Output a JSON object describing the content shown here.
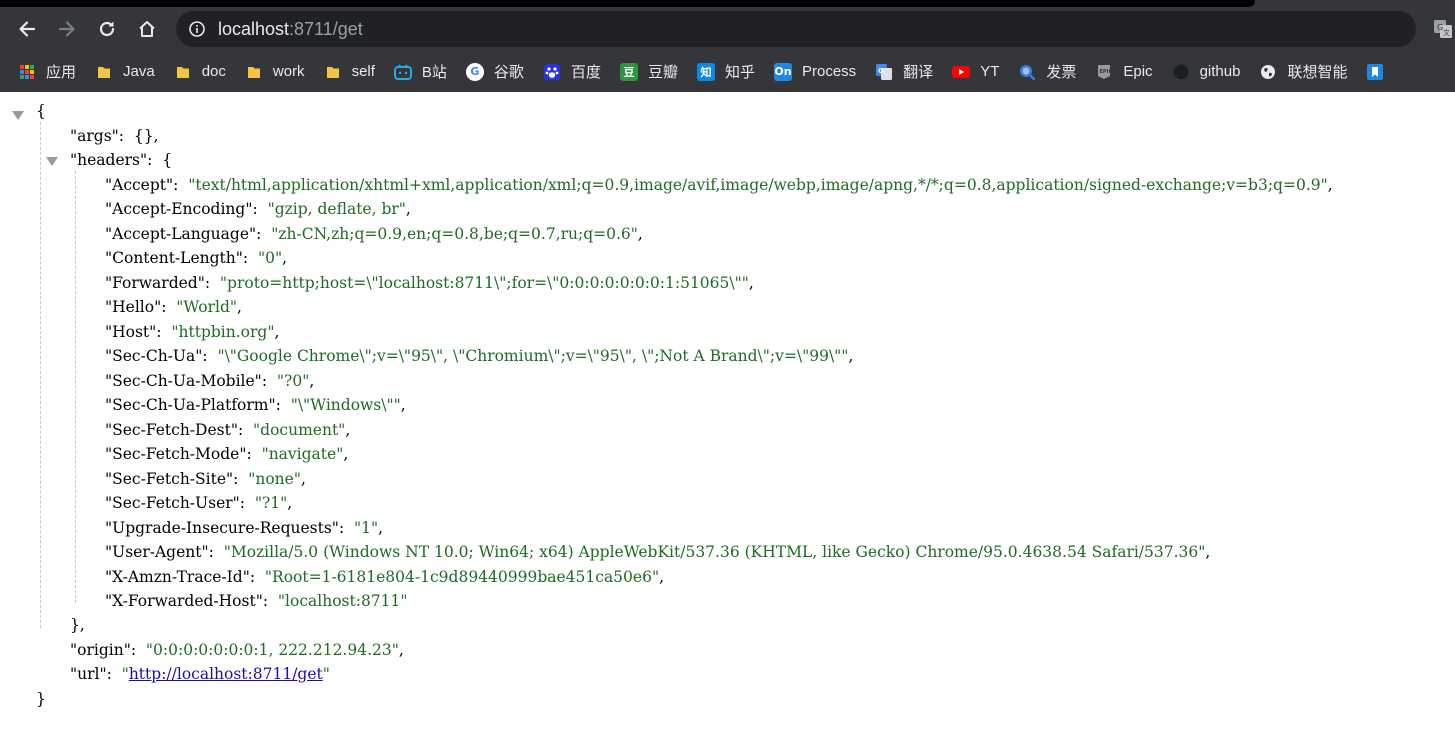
{
  "browser": {
    "url_host": "localhost",
    "url_rest": ":8711/get",
    "bookmarks": [
      {
        "label": "应用",
        "icon": "apps-grid-icon",
        "color": "#e8453c"
      },
      {
        "label": "Java",
        "icon": "folder-icon",
        "color": "#f4c542"
      },
      {
        "label": "doc",
        "icon": "folder-icon",
        "color": "#f4c542"
      },
      {
        "label": "work",
        "icon": "folder-icon",
        "color": "#f4c542"
      },
      {
        "label": "self",
        "icon": "folder-icon",
        "color": "#f4c542"
      },
      {
        "label": "B站",
        "icon": "bilibili-icon",
        "color": "#23ade5"
      },
      {
        "label": "谷歌",
        "icon": "google-icon",
        "color": "#ffffff"
      },
      {
        "label": "百度",
        "icon": "baidu-icon",
        "color": "#2932e1"
      },
      {
        "label": "豆瓣",
        "icon": "douban-icon",
        "color": "#2e963d"
      },
      {
        "label": "知乎",
        "icon": "zhihu-icon",
        "color": "#0f88eb"
      },
      {
        "label": "Process",
        "icon": "processon-icon",
        "color": "#1e88e5"
      },
      {
        "label": "翻译",
        "icon": "translate-icon",
        "color": "#4285f4"
      },
      {
        "label": "YT",
        "icon": "youtube-icon",
        "color": "#ff0000"
      },
      {
        "label": "发票",
        "icon": "invoice-icon",
        "color": "#3d7be0"
      },
      {
        "label": "Epic",
        "icon": "epic-icon",
        "color": "#9a9a9a"
      },
      {
        "label": "github",
        "icon": "github-icon",
        "color": "#1b1f23"
      },
      {
        "label": "联想智能",
        "icon": "globe-icon",
        "color": "#e8eaed"
      },
      {
        "label": "",
        "icon": "bookmark-icon",
        "color": "#1e88e5"
      }
    ]
  },
  "json": {
    "open_brace": "{",
    "args_key": "\"args\"",
    "args_value": "{},",
    "headers_key": "\"headers\"",
    "headers_open": "{",
    "headers": [
      {
        "key": "\"Accept\"",
        "value": "\"text/html,application/xhtml+xml,application/xml;q=0.9,image/avif,image/webp,image/apng,*/*;q=0.8,application/signed-exchange;v=b3;q=0.9\"",
        "sep": ","
      },
      {
        "key": "\"Accept-Encoding\"",
        "value": "\"gzip, deflate, br\"",
        "sep": ","
      },
      {
        "key": "\"Accept-Language\"",
        "value": "\"zh-CN,zh;q=0.9,en;q=0.8,be;q=0.7,ru;q=0.6\"",
        "sep": ","
      },
      {
        "key": "\"Content-Length\"",
        "value": "\"0\"",
        "sep": ","
      },
      {
        "key": "\"Forwarded\"",
        "value": "\"proto=http;host=\\\"localhost:8711\\\";for=\\\"0:0:0:0:0:0:0:1:51065\\\"\"",
        "sep": ","
      },
      {
        "key": "\"Hello\"",
        "value": "\"World\"",
        "sep": ","
      },
      {
        "key": "\"Host\"",
        "value": "\"httpbin.org\"",
        "sep": ","
      },
      {
        "key": "\"Sec-Ch-Ua\"",
        "value": "\"\\\"Google Chrome\\\";v=\\\"95\\\", \\\"Chromium\\\";v=\\\"95\\\", \\\";Not A Brand\\\";v=\\\"99\\\"\"",
        "sep": ","
      },
      {
        "key": "\"Sec-Ch-Ua-Mobile\"",
        "value": "\"?0\"",
        "sep": ","
      },
      {
        "key": "\"Sec-Ch-Ua-Platform\"",
        "value": "\"\\\"Windows\\\"\"",
        "sep": ","
      },
      {
        "key": "\"Sec-Fetch-Dest\"",
        "value": "\"document\"",
        "sep": ","
      },
      {
        "key": "\"Sec-Fetch-Mode\"",
        "value": "\"navigate\"",
        "sep": ","
      },
      {
        "key": "\"Sec-Fetch-Site\"",
        "value": "\"none\"",
        "sep": ","
      },
      {
        "key": "\"Sec-Fetch-User\"",
        "value": "\"?1\"",
        "sep": ","
      },
      {
        "key": "\"Upgrade-Insecure-Requests\"",
        "value": "\"1\"",
        "sep": ","
      },
      {
        "key": "\"User-Agent\"",
        "value": "\"Mozilla/5.0 (Windows NT 10.0; Win64; x64) AppleWebKit/537.36 (KHTML, like Gecko) Chrome/95.0.4638.54 Safari/537.36\"",
        "sep": ","
      },
      {
        "key": "\"X-Amzn-Trace-Id\"",
        "value": "\"Root=1-6181e804-1c9d89440999bae451ca50e6\"",
        "sep": ","
      },
      {
        "key": "\"X-Forwarded-Host\"",
        "value": "\"localhost:8711\"",
        "sep": ""
      }
    ],
    "headers_close": "},",
    "origin_key": "\"origin\"",
    "origin_value": "\"0:0:0:0:0:0:0:1, 222.212.94.23\"",
    "url_key": "\"url\"",
    "url_quote_open": "\"",
    "url_value": "http://localhost:8711/get",
    "url_quote_close": "\"",
    "close_brace": "}"
  }
}
